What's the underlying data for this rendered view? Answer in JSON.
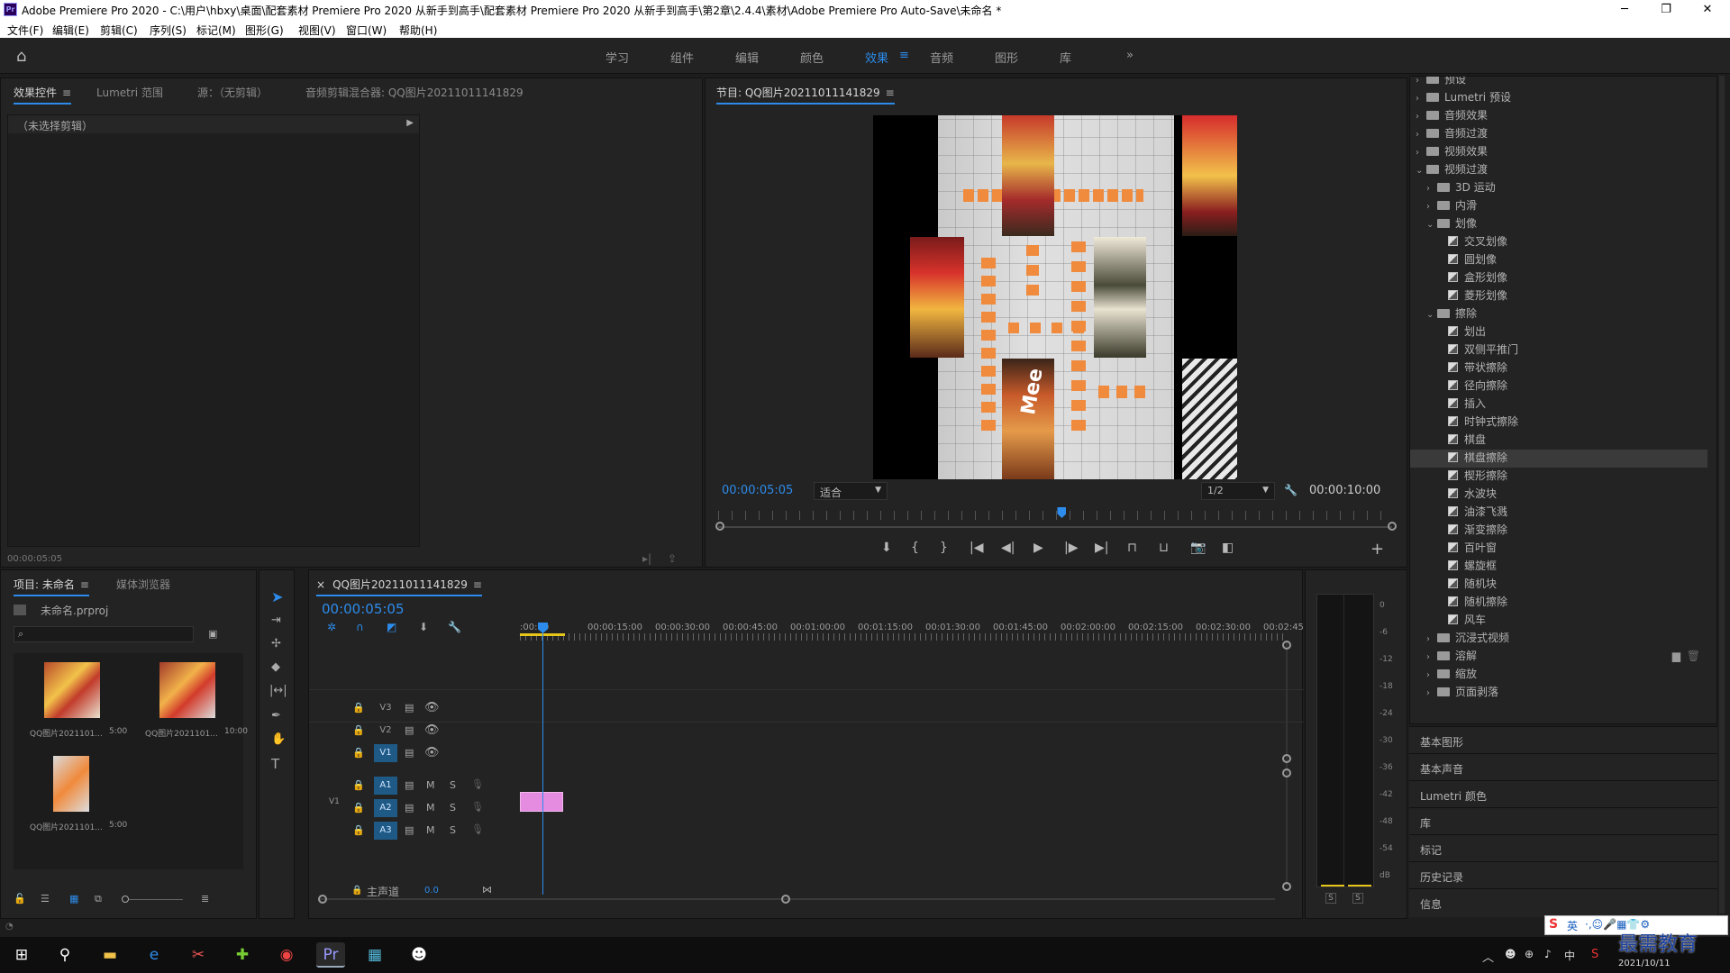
{
  "window": {
    "title": "Adobe Premiere Pro 2020 - C:\\用户\\hbxy\\桌面\\配套素材 Premiere Pro 2020 从新手到高手\\配套素材 Premiere Pro 2020 从新手到高手\\第2章\\2.4.4\\素材\\Adobe Premiere Pro Auto-Save\\未命名 *",
    "logo": "Pr",
    "controls": {
      "minimize": "─",
      "maximize": "❐",
      "close": "✕"
    }
  },
  "menu": [
    "文件(F)",
    "编辑(E)",
    "剪辑(C)",
    "序列(S)",
    "标记(M)",
    "图形(G)",
    "视图(V)",
    "窗口(W)",
    "帮助(H)"
  ],
  "workspaces": {
    "items": [
      "学习",
      "组件",
      "编辑",
      "颜色",
      "效果",
      "音频",
      "图形",
      "库"
    ],
    "active": "效果",
    "more": "»"
  },
  "source_panel": {
    "tabs": [
      "效果控件",
      "Lumetri 范围",
      "源：（无剪辑）",
      "音频剪辑混合器: QQ图片20211011141829"
    ],
    "no_clip": "（未选择剪辑）",
    "timecode": "00:00:05:05"
  },
  "program_monitor": {
    "title": "节目: QQ图片20211011141829",
    "timecode": "00:00:05:05",
    "fit": "适合",
    "resolution": "1/2",
    "duration": "00:00:10:00",
    "playhead_fraction": 0.51,
    "preview_text": "Mee"
  },
  "effects_panel": {
    "items": [
      {
        "label": "预设",
        "type": "folder",
        "depth": 0,
        "open": false
      },
      {
        "label": "Lumetri 预设",
        "type": "folder",
        "depth": 0,
        "open": false
      },
      {
        "label": "音频效果",
        "type": "folder",
        "depth": 0,
        "open": false
      },
      {
        "label": "音频过渡",
        "type": "folder",
        "depth": 0,
        "open": false
      },
      {
        "label": "视频效果",
        "type": "folder",
        "depth": 0,
        "open": false
      },
      {
        "label": "视频过渡",
        "type": "folder",
        "depth": 0,
        "open": true
      },
      {
        "label": "3D 运动",
        "type": "folder",
        "depth": 1,
        "open": false
      },
      {
        "label": "内滑",
        "type": "folder",
        "depth": 1,
        "open": false
      },
      {
        "label": "划像",
        "type": "folder",
        "depth": 1,
        "open": true
      },
      {
        "label": "交叉划像",
        "type": "effect",
        "depth": 2
      },
      {
        "label": "圆划像",
        "type": "effect",
        "depth": 2
      },
      {
        "label": "盒形划像",
        "type": "effect",
        "depth": 2
      },
      {
        "label": "菱形划像",
        "type": "effect",
        "depth": 2
      },
      {
        "label": "擦除",
        "type": "folder",
        "depth": 1,
        "open": true
      },
      {
        "label": "划出",
        "type": "effect",
        "depth": 2
      },
      {
        "label": "双侧平推门",
        "type": "effect",
        "depth": 2
      },
      {
        "label": "带状擦除",
        "type": "effect",
        "depth": 2
      },
      {
        "label": "径向擦除",
        "type": "effect",
        "depth": 2
      },
      {
        "label": "插入",
        "type": "effect",
        "depth": 2
      },
      {
        "label": "时钟式擦除",
        "type": "effect",
        "depth": 2
      },
      {
        "label": "棋盘",
        "type": "effect",
        "depth": 2
      },
      {
        "label": "棋盘擦除",
        "type": "effect",
        "depth": 2,
        "selected": true
      },
      {
        "label": "楔形擦除",
        "type": "effect",
        "depth": 2
      },
      {
        "label": "水波块",
        "type": "effect",
        "depth": 2
      },
      {
        "label": "油漆飞溅",
        "type": "effect",
        "depth": 2
      },
      {
        "label": "渐变擦除",
        "type": "effect",
        "depth": 2
      },
      {
        "label": "百叶窗",
        "type": "effect",
        "depth": 2
      },
      {
        "label": "螺旋框",
        "type": "effect",
        "depth": 2
      },
      {
        "label": "随机块",
        "type": "effect",
        "depth": 2
      },
      {
        "label": "随机擦除",
        "type": "effect",
        "depth": 2
      },
      {
        "label": "风车",
        "type": "effect",
        "depth": 2
      },
      {
        "label": "沉浸式视频",
        "type": "folder",
        "depth": 1,
        "open": false
      },
      {
        "label": "溶解",
        "type": "folder",
        "depth": 1,
        "open": false
      },
      {
        "label": "缩放",
        "type": "folder",
        "depth": 1,
        "open": false
      },
      {
        "label": "页面剥落",
        "type": "folder",
        "depth": 1,
        "open": false
      }
    ]
  },
  "side_panels": [
    "基本图形",
    "基本声音",
    "Lumetri 颜色",
    "库",
    "标记",
    "历史记录",
    "信息"
  ],
  "project_panel": {
    "tabs": [
      "项目: 未命名",
      "媒体浏览器"
    ],
    "project_file": "未命名.prproj",
    "search_placeholder": "",
    "items": [
      {
        "name": "QQ图片2021101...",
        "duration": "5:00"
      },
      {
        "name": "QQ图片2021101...",
        "duration": "10:00"
      },
      {
        "name": "QQ图片2021101...",
        "duration": "5:00"
      }
    ]
  },
  "timeline": {
    "sequence": "QQ图片20211011141829",
    "timecode": "00:00:05:05",
    "ruler": [
      ":00:00",
      "00:00:15:00",
      "00:00:30:00",
      "00:00:45:00",
      "00:01:00:00",
      "00:01:15:00",
      "00:01:30:00",
      "00:01:45:00",
      "00:02:00:00",
      "00:02:15:00",
      "00:02:30:00",
      "00:02:45:"
    ],
    "video_tracks": [
      "V3",
      "V2",
      "V1"
    ],
    "audio_tracks": [
      "A1",
      "A2",
      "A3"
    ],
    "source_patch": "V1",
    "master": {
      "label": "主声道",
      "value": "0.0"
    },
    "mute": "M",
    "solo": "S"
  },
  "audio_meter": {
    "scale": [
      "0",
      "-6",
      "-12",
      "-18",
      "-24",
      "-30",
      "-36",
      "-42",
      "-48",
      "-54",
      "dB"
    ],
    "solo": [
      "S",
      "S"
    ]
  },
  "taskbar": {
    "date": "2021/10/11",
    "ime": "英",
    "watermark": "最需教育"
  },
  "colors": {
    "accent": "#2d8ceb",
    "clip": "#e58be0",
    "panel": "#232323",
    "background": "#1d1d1d"
  }
}
